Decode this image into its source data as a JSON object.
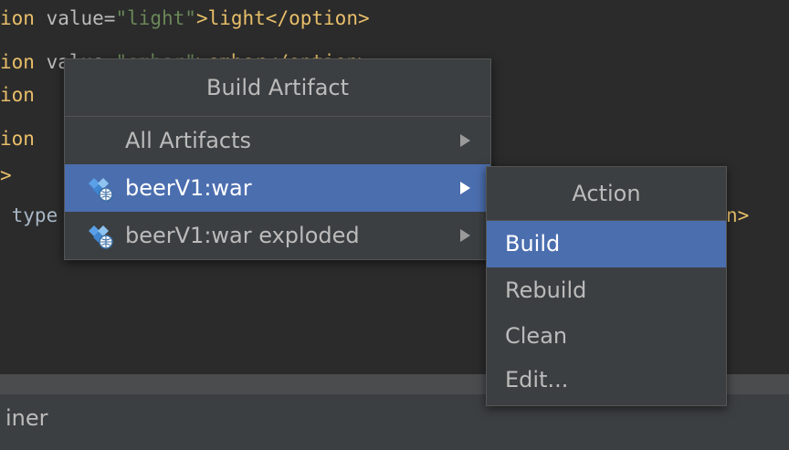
{
  "editor": {
    "lines": [
      {
        "parts": [
          "ion ",
          "value=",
          "\"light\"",
          ">light</option>"
        ]
      },
      {
        "parts": [
          "ion ",
          "value=",
          "\"ember\"",
          ">ember</option>"
        ]
      },
      {
        "parts": [
          "ion",
          "",
          "",
          ""
        ]
      },
      {
        "parts": [
          "ion",
          "",
          "",
          ""
        ]
      },
      {
        "parts": [
          ">",
          "",
          "",
          ""
        ]
      },
      {
        "parts": [
          " type",
          "",
          "",
          ""
        ]
      }
    ],
    "right_fragment": "n>"
  },
  "statusbar": {
    "text": "iner"
  },
  "build_menu": {
    "title": "Build Artifact",
    "items": [
      {
        "label": "All Artifacts",
        "has_icon": false
      },
      {
        "label": "beerV1:war",
        "has_icon": true
      },
      {
        "label": "beerV1:war exploded",
        "has_icon": true
      }
    ]
  },
  "action_menu": {
    "title": "Action",
    "items": [
      {
        "label": "Build"
      },
      {
        "label": "Rebuild"
      },
      {
        "label": "Clean"
      },
      {
        "label": "Edit..."
      }
    ]
  },
  "colors": {
    "selection": "#4b6eaf",
    "popup_bg": "#3c3f41",
    "editor_bg": "#2b2b2b"
  }
}
